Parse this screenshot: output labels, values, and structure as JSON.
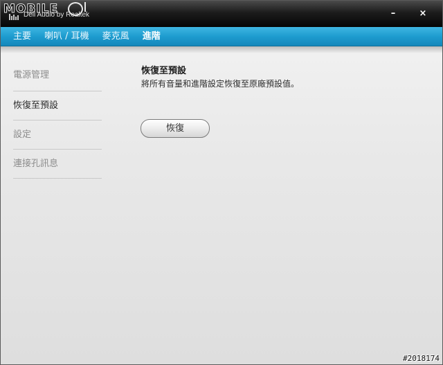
{
  "titlebar": {
    "logo_text": "MOBILE",
    "app_title": "Dell Audio by Realtek",
    "minimize_label": "–",
    "close_label": "×"
  },
  "nav": {
    "tabs": [
      {
        "label": "主要",
        "active": false
      },
      {
        "label": "喇叭 / 耳機",
        "active": false
      },
      {
        "label": "麥克風",
        "active": false
      },
      {
        "label": "進階",
        "active": true
      }
    ]
  },
  "sidebar": {
    "items": [
      {
        "label": "電源管理",
        "active": false
      },
      {
        "label": "恢復至預設",
        "active": true
      },
      {
        "label": "設定",
        "active": false
      },
      {
        "label": "連接孔訊息",
        "active": false
      }
    ]
  },
  "main": {
    "title": "恢復至預設",
    "description": "將所有音量和進階設定恢復至原廠預設值。",
    "restore_button": "恢復"
  },
  "watermark": "#2018174",
  "colors": {
    "nav_accent": "#1e9ccf",
    "titlebar": "#0a0a0a"
  }
}
